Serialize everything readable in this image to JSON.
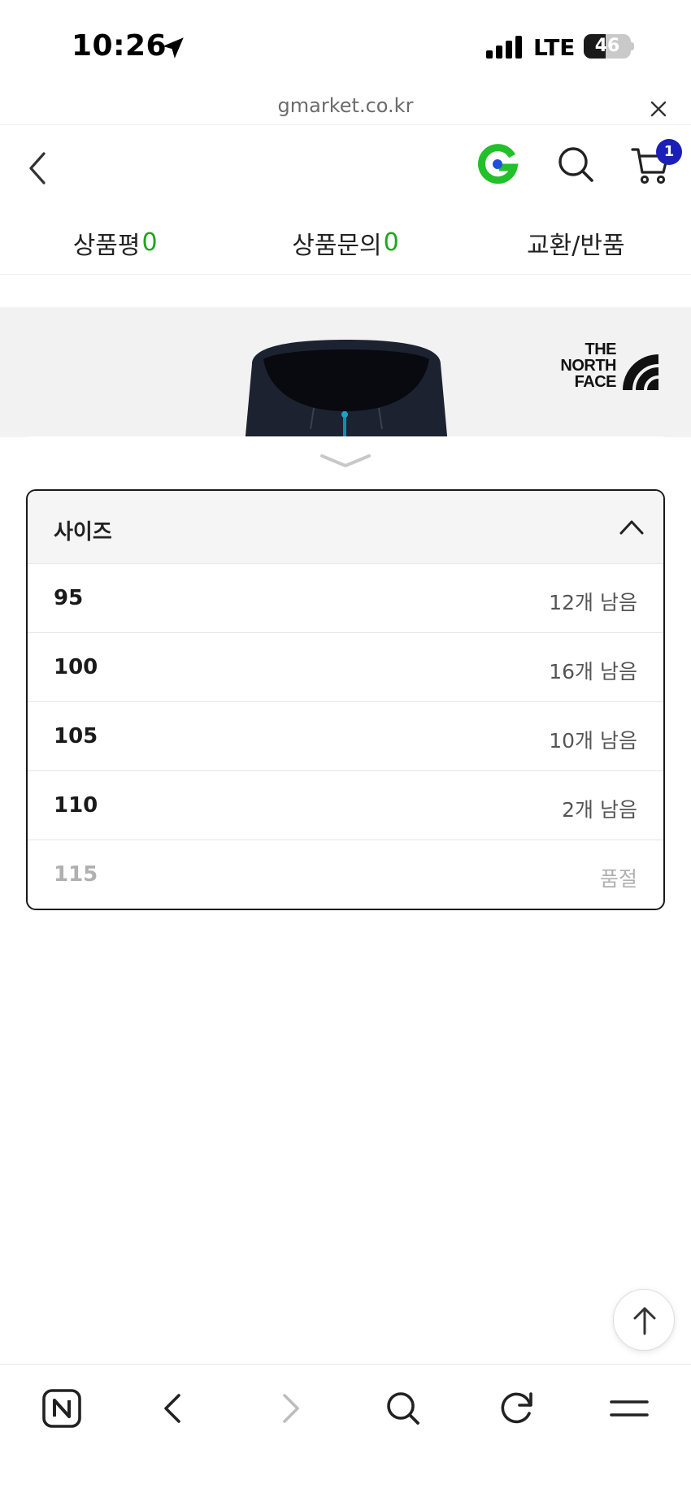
{
  "status_bar": {
    "time": "10:26",
    "carrier": "LTE",
    "battery_level": "46",
    "battery_fraction": 0.46
  },
  "url_bar": {
    "domain": "gmarket.co.kr"
  },
  "header": {
    "cart_count": "1"
  },
  "tabs": [
    {
      "label": "상품평",
      "count": "0"
    },
    {
      "label": "상품문의",
      "count": "0"
    },
    {
      "label": "교환/반품",
      "count": ""
    }
  ],
  "product": {
    "brand_logo_text": "THE NORTH FACE"
  },
  "size_dropdown": {
    "title": "사이즈",
    "options": [
      {
        "size": "95",
        "stock": "12개 남음",
        "available": true
      },
      {
        "size": "100",
        "stock": "16개 남음",
        "available": true
      },
      {
        "size": "105",
        "stock": "10개 남음",
        "available": true
      },
      {
        "size": "110",
        "stock": "2개 남음",
        "available": true
      },
      {
        "size": "115",
        "stock": "품절",
        "available": false
      }
    ]
  },
  "colors": {
    "accent_green": "#1fa51f",
    "badge_blue": "#1a1fb8",
    "g_logo_green": "#22c02a",
    "g_logo_blue": "#1f4fd8"
  },
  "icons": {
    "location": "location-arrow-icon",
    "signal": "signal-bars-icon",
    "close": "close-icon",
    "back": "chevron-left-icon",
    "g_logo": "gmarket-g-logo",
    "search": "search-icon",
    "cart": "cart-icon",
    "collapse": "chevron-up-icon",
    "sheet_handle": "chevron-down-icon",
    "scroll_top": "arrow-up-icon",
    "naver": "naver-n-icon",
    "forward": "chevron-right-icon",
    "reload": "reload-icon",
    "menu": "menu-icon"
  }
}
